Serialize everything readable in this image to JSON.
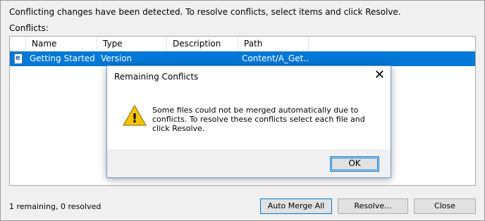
{
  "info_text": "Conflicting changes have been detected.  To resolve conflicts, select items and click Resolve.",
  "conflicts_label": "Conflicts:",
  "columns": [
    "Name",
    "Type",
    "Description",
    "Path"
  ],
  "rows": [
    {
      "name": "Getting Started...",
      "type": "Version",
      "description": "",
      "path": "Content/A_Get..."
    }
  ],
  "status": "1 remaining, 0 resolved",
  "buttons": {
    "auto_merge": "Auto Merge All",
    "resolve": "Resolve...",
    "close": "Close"
  },
  "dialog": {
    "title": "Remaining Conflicts",
    "message": "Some files could not be merged automatically due to conflicts.  To resolve these conflicts select each file and click Resolve.",
    "ok": "OK",
    "close_glyph": "✕"
  },
  "icons": {
    "file_glyph": "e",
    "warning_glyph": "!"
  },
  "colors": {
    "selection": "#0078d7",
    "warning": "#f5c400"
  }
}
